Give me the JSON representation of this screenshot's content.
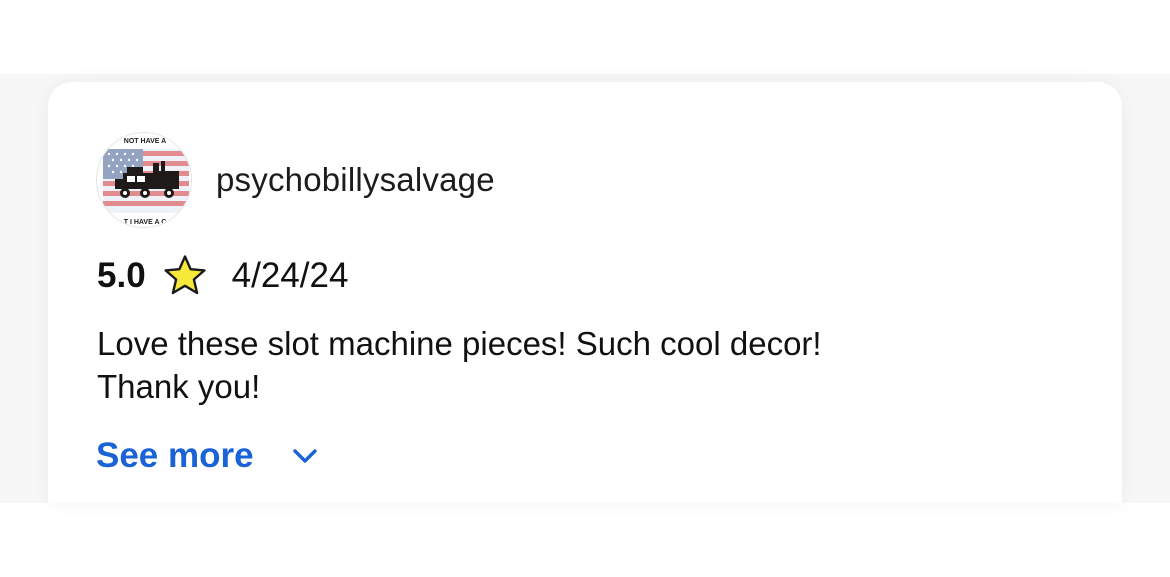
{
  "review": {
    "username": "psychobillysalvage",
    "avatar": {
      "icon": "flag-truck-logo-icon",
      "text_top": "NOT HAVE A",
      "text_bottom": "T I HAVE A C"
    },
    "rating": "5.0",
    "rating_icon": "star-icon",
    "date": "4/24/24",
    "text": "Love these slot machine pieces! Such cool decor!\nThank you!",
    "see_more_label": "See more",
    "see_more_icon": "chevron-down-icon"
  },
  "colors": {
    "link": "#1a63d6",
    "star_fill": "#f7e83a",
    "text": "#111111"
  }
}
